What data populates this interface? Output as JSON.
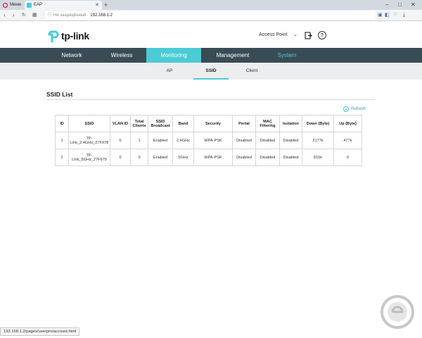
{
  "browser": {
    "menu_tab": "Меню",
    "active_tab": "EAP",
    "insecure_label": "Не защищённый",
    "url": "192.168.1.2"
  },
  "header": {
    "logo_text": "tp-link",
    "mode_label": "Access Point"
  },
  "main_nav": [
    "Network",
    "Wireless",
    "Monitoring",
    "Management",
    "System"
  ],
  "sub_nav": [
    "AP",
    "SSID",
    "Client"
  ],
  "section": {
    "title": "SSID List",
    "refresh_label": "Refresh"
  },
  "table": {
    "headers": [
      "ID",
      "SSID",
      "VLAN ID",
      "Total Clients",
      "SSID Broadcast",
      "Band",
      "Security",
      "Portal",
      "MAC Filtering",
      "Isolation",
      "Down (Byte)",
      "Up (Byte)"
    ],
    "rows": [
      [
        "1",
        "TP-Link_2.4GHz_27F978",
        "0",
        "1",
        "Enabled",
        "2.4GHz",
        "WPA-PSK",
        "Disabled",
        "Disabled",
        "Disabled",
        "2177k",
        "477k"
      ],
      [
        "2",
        "TP-Link_5GHz_27F979",
        "0",
        "0",
        "Enabled",
        "5GHz",
        "WPA-PSK",
        "Disabled",
        "Disabled",
        "Disabled",
        "815k",
        "0"
      ]
    ]
  },
  "status_bar": "192.168.1.2/pages/userpm/account.html",
  "colors": {
    "accent": "#4acbd6",
    "nav_bg": "#394b55"
  }
}
